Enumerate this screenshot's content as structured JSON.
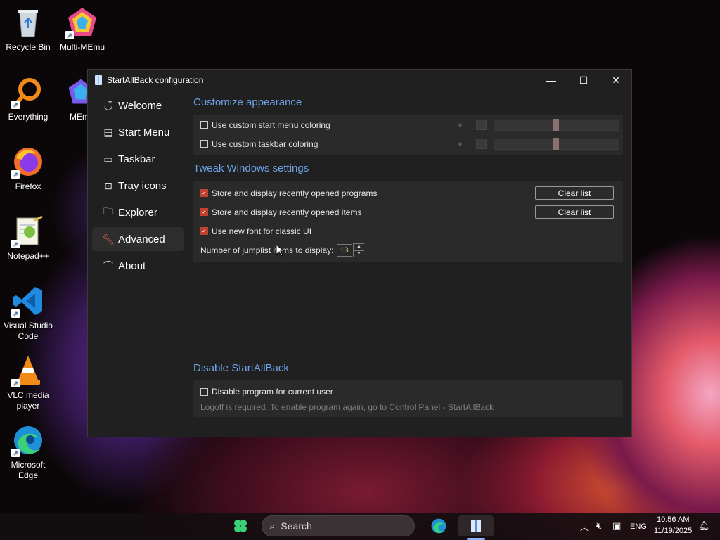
{
  "desktop": {
    "icons": [
      {
        "label": "Recycle Bin",
        "icon": "recycle-bin-icon"
      },
      {
        "label": "Multi-MEmu",
        "icon": "memu-icon"
      },
      {
        "label": "Everything",
        "icon": "everything-search-icon"
      },
      {
        "label": "MEmu",
        "icon": "memu-icon"
      },
      {
        "label": "Firefox",
        "icon": "firefox-icon"
      },
      {
        "label": "Notepad++",
        "icon": "notepad-plus-plus-icon"
      },
      {
        "label": "Visual Studio Code",
        "icon": "vscode-icon"
      },
      {
        "label": "VLC media player",
        "icon": "vlc-icon"
      },
      {
        "label": "Microsoft Edge",
        "icon": "edge-icon"
      }
    ]
  },
  "window": {
    "title": "StartAllBack configuration",
    "controls": {
      "minimize": "—",
      "maximize": "☐",
      "close": "✕"
    }
  },
  "sidebar": {
    "items": [
      {
        "label": "Welcome",
        "icon": "smile-icon"
      },
      {
        "label": "Start Menu",
        "icon": "start-menu-icon"
      },
      {
        "label": "Taskbar",
        "icon": "taskbar-icon"
      },
      {
        "label": "Tray icons",
        "icon": "tray-icon"
      },
      {
        "label": "Explorer",
        "icon": "folder-icon"
      },
      {
        "label": "Advanced",
        "icon": "wrench-icon",
        "active": true
      },
      {
        "label": "About",
        "icon": "about-icon"
      }
    ]
  },
  "sections": {
    "appearance": {
      "title": "Customize appearance",
      "start_menu_coloring": {
        "label": "Use custom start menu coloring",
        "checked": false,
        "slider": 0.5
      },
      "taskbar_coloring": {
        "label": "Use custom taskbar coloring",
        "checked": false,
        "slider": 0.5
      }
    },
    "tweak": {
      "title": "Tweak Windows settings",
      "recent_programs": {
        "label": "Store and display recently opened programs",
        "checked": true,
        "button": "Clear list"
      },
      "recent_items": {
        "label": "Store and display recently opened items",
        "checked": true,
        "button": "Clear list"
      },
      "new_font": {
        "label": "Use new font for classic UI",
        "checked": true
      },
      "jumplist": {
        "label": "Number of jumplist items to display:",
        "value": "13"
      }
    },
    "disable": {
      "title": "Disable StartAllBack",
      "disable_program": {
        "label": "Disable program for current user",
        "checked": false
      },
      "hint": "Logoff is required. To enable program again, go to Control Panel - StartAllBack"
    }
  },
  "taskbar": {
    "search_placeholder": "Search",
    "language": "ENG",
    "time": "10:56 AM",
    "date": "11/19/2025"
  },
  "colors": {
    "accent_blue": "#6fa3e8",
    "checkbox_checked": "#c04030",
    "window_bg": "#202020",
    "panel_bg": "#2a2a2a"
  }
}
